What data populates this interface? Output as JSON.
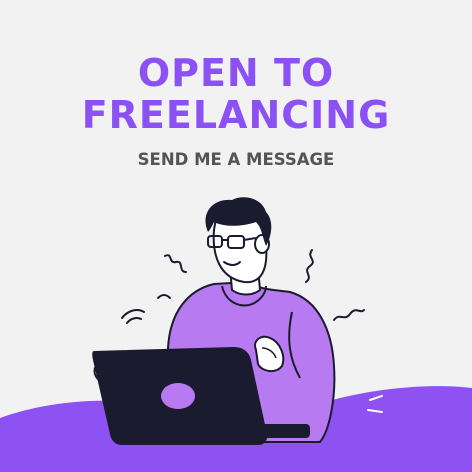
{
  "headline": {
    "line1": "OPEN TO",
    "line2": "FREELANCING"
  },
  "subtitle": "SEND ME A MESSAGE",
  "illustration": {
    "subject": "person-typing-on-laptop",
    "icons": [
      "worried-squiggle-icon",
      "wifi-signal-icon",
      "laptop-logo-icon"
    ]
  },
  "colors": {
    "background": "#f3f2f3",
    "accent": "#8b51f5",
    "sweater": "#b77af0",
    "ground": "#8e52f2",
    "laptop": "#1b1b2f",
    "text_secondary": "#545454"
  }
}
